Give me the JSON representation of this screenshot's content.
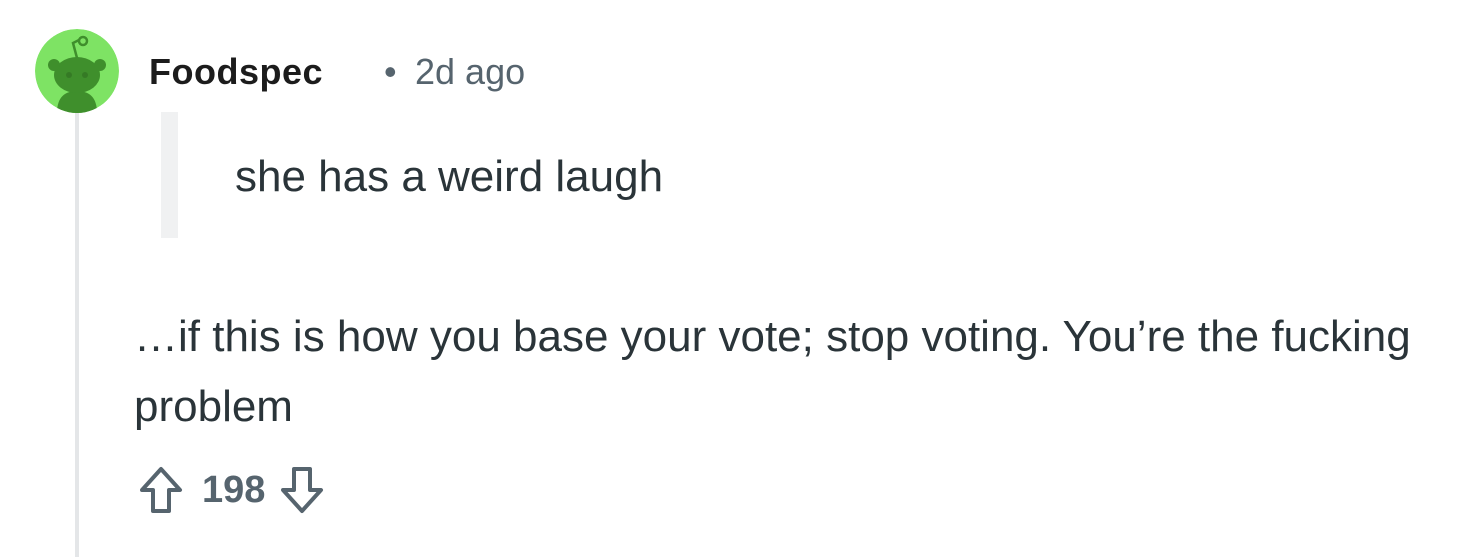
{
  "comment": {
    "author": "Foodspec",
    "separator": "•",
    "timestamp": "2d ago",
    "quoted_text": "she has a weird laugh",
    "body": "…if this is how you base your vote; stop voting. You’re the fucking problem",
    "score": "198"
  },
  "icons": {
    "avatar": "snoo-avatar-icon",
    "upvote": "arrow-up-icon",
    "downvote": "arrow-down-icon"
  },
  "colors": {
    "avatar_background": "#7ee364",
    "avatar_figure": "#3f8f2c",
    "thread_line": "#e4e6e8",
    "quote_bar": "#f0f1f2",
    "meta_text": "#56646e",
    "body_text": "#2a3439"
  }
}
